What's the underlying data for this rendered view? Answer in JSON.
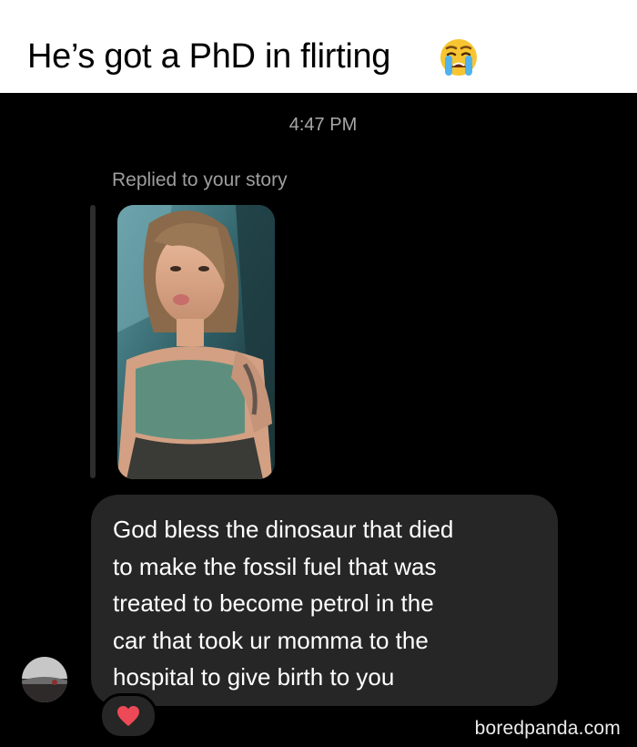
{
  "caption": {
    "text": "He’s got a PhD in flirting",
    "emoji": "crying-face-icon"
  },
  "chat": {
    "timestamp": "4:47 PM",
    "reply_context": "Replied to your story",
    "story_preview": "story-photo",
    "message": "God bless the dinosaur that died\nto make the fossil fuel that was\ntreated to become petrol in the\ncar that took ur momma to the\nhospital to give birth to you",
    "reaction": "heart-icon",
    "avatar": "avatar-icon"
  },
  "watermark": "boredpanda.com",
  "colors": {
    "chat_background": "#000000",
    "bubble": "#262626",
    "timestamp": "#a8a8a8",
    "heart": "#ed4956"
  }
}
